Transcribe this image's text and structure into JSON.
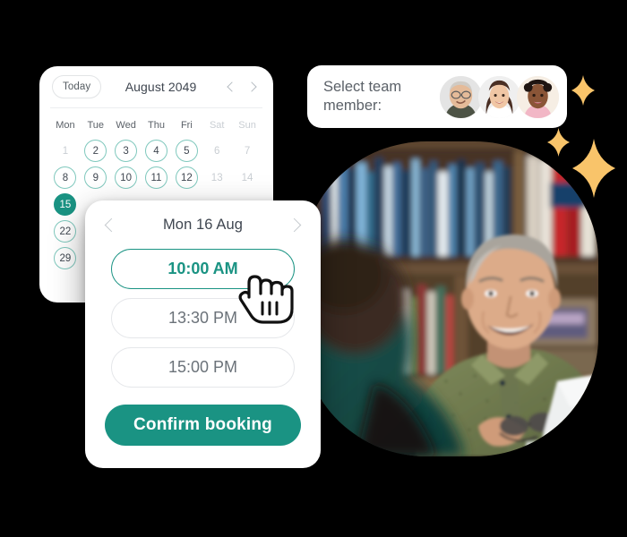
{
  "theme": {
    "accent": "#1a9383",
    "accent_light": "#7fc8bd",
    "sparkle": "#fac濃"
  },
  "colors": {
    "accent": "#1a9383",
    "accent_outline": "#7fc8bd",
    "sparkle_amber": "#f9c46a",
    "text_dark": "#3f4650",
    "text_muted": "#c9ced3",
    "card_bg": "#ffffff",
    "page_bg": "#000000"
  },
  "calendar": {
    "today_label": "Today",
    "month_title": "August 2049",
    "prev_icon": "chevron-left-icon",
    "next_icon": "chevron-right-icon",
    "day_headers": [
      {
        "label": "Mon",
        "muted": false
      },
      {
        "label": "Tue",
        "muted": false
      },
      {
        "label": "Wed",
        "muted": false
      },
      {
        "label": "Thu",
        "muted": false
      },
      {
        "label": "Fri",
        "muted": false
      },
      {
        "label": "Sat",
        "muted": true
      },
      {
        "label": "Sun",
        "muted": true
      }
    ],
    "weeks": [
      [
        {
          "day": "1",
          "state": "off"
        },
        {
          "day": "2",
          "state": "available"
        },
        {
          "day": "3",
          "state": "available"
        },
        {
          "day": "4",
          "state": "available"
        },
        {
          "day": "5",
          "state": "available"
        },
        {
          "day": "6",
          "state": "off"
        },
        {
          "day": "7",
          "state": "off"
        }
      ],
      [
        {
          "day": "8",
          "state": "available"
        },
        {
          "day": "9",
          "state": "available"
        },
        {
          "day": "10",
          "state": "available"
        },
        {
          "day": "11",
          "state": "available"
        },
        {
          "day": "12",
          "state": "available"
        },
        {
          "day": "13",
          "state": "off"
        },
        {
          "day": "14",
          "state": "off"
        }
      ],
      [
        {
          "day": "15",
          "state": "selected"
        },
        {
          "day": "",
          "state": "hidden"
        },
        {
          "day": "",
          "state": "hidden"
        },
        {
          "day": "",
          "state": "hidden"
        },
        {
          "day": "",
          "state": "hidden"
        },
        {
          "day": "",
          "state": "hidden"
        },
        {
          "day": "",
          "state": "hidden"
        }
      ],
      [
        {
          "day": "22",
          "state": "available"
        },
        {
          "day": "",
          "state": "hidden"
        },
        {
          "day": "",
          "state": "hidden"
        },
        {
          "day": "",
          "state": "hidden"
        },
        {
          "day": "",
          "state": "hidden"
        },
        {
          "day": "",
          "state": "hidden"
        },
        {
          "day": "",
          "state": "hidden"
        }
      ],
      [
        {
          "day": "29",
          "state": "available"
        },
        {
          "day": "",
          "state": "hidden"
        },
        {
          "day": "",
          "state": "hidden"
        },
        {
          "day": "",
          "state": "hidden"
        },
        {
          "day": "",
          "state": "hidden"
        },
        {
          "day": "",
          "state": "hidden"
        },
        {
          "day": "",
          "state": "hidden"
        }
      ]
    ]
  },
  "booking": {
    "prev_icon": "chevron-left-icon",
    "next_icon": "chevron-right-icon",
    "date_title": "Mon 16 Aug",
    "slots": [
      {
        "label": "10:00 AM",
        "selected": true
      },
      {
        "label": "13:30 PM",
        "selected": false
      },
      {
        "label": "15:00 PM",
        "selected": false
      }
    ],
    "confirm_label": "Confirm booking"
  },
  "team": {
    "label": "Select team member:",
    "avatars": [
      {
        "name": "avatar-team-member-1"
      },
      {
        "name": "avatar-team-member-2"
      },
      {
        "name": "avatar-team-member-3"
      }
    ]
  },
  "photo": {
    "alt": "Smiling man in green shirt talking with a person in a library"
  },
  "cursor": {
    "icon": "pointing-hand-cursor"
  },
  "sparkles": [
    {
      "name": "sparkle-small-top"
    },
    {
      "name": "sparkle-small-left"
    },
    {
      "name": "sparkle-large"
    }
  ]
}
